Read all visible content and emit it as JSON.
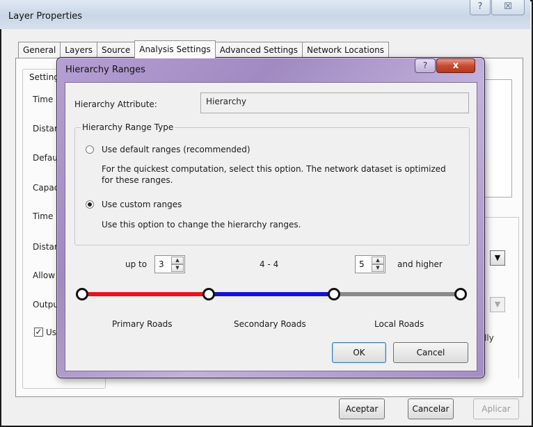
{
  "outer_window": {
    "title": "Layer Properties",
    "help_glyph": "?",
    "close_glyph": "☒",
    "tabs": [
      "General",
      "Layers",
      "Source",
      "Analysis Settings",
      "Advanced Settings",
      "Network Locations"
    ],
    "active_tab": "Analysis Settings",
    "settings_group_label": "Setting",
    "settings_labels": [
      "Time",
      "Distar",
      "Defau",
      "Capac",
      "Time F",
      "Distar",
      "Allow",
      "Outpu",
      "Us"
    ],
    "settings_checkbox_checked": true,
    "partial_right_text": "lly",
    "buttons": {
      "ok": "Aceptar",
      "cancel": "Cancelar",
      "apply": "Aplicar"
    }
  },
  "dialog": {
    "title": "Hierarchy Ranges",
    "help_glyph": "?",
    "close_glyph": "x",
    "attribute_label": "Hierarchy Attribute:",
    "attribute_value": "Hierarchy",
    "range_type_label": "Hierarchy Range Type",
    "option_default": {
      "label": "Use default ranges (recommended)",
      "description_line1": "For the quickest computation, select this option.  The network dataset is optimized",
      "description_line2": "for these ranges.",
      "checked": false
    },
    "option_custom": {
      "label": "Use custom ranges",
      "description": "Use this option to change the hierarchy ranges.",
      "checked": true
    },
    "upper_prefix": "up to",
    "upper_value": "3",
    "middle_range": "4 - 4",
    "lower_value": "5",
    "lower_suffix": "and higher",
    "roads": [
      {
        "label": "Primary Roads",
        "color": "#e8141c"
      },
      {
        "label": "Secondary Roads",
        "color": "#1412d6"
      },
      {
        "label": "Local Roads",
        "color": "#8a8a8a"
      }
    ],
    "buttons": {
      "ok": "OK",
      "cancel": "Cancel"
    }
  }
}
